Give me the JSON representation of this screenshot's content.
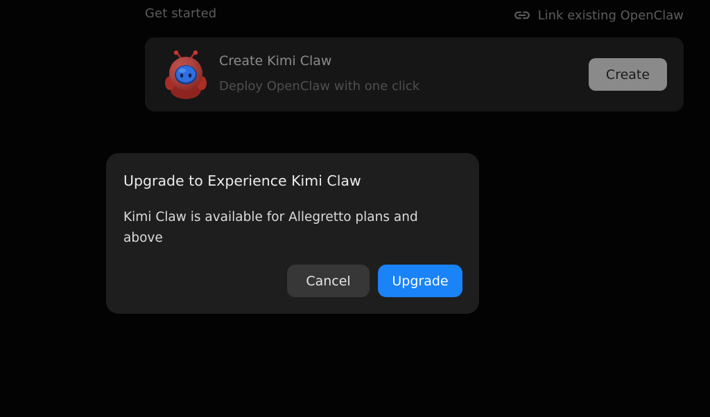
{
  "header": {
    "section_title": "Get started",
    "link_label": "Link existing OpenClaw",
    "link_icon": "link-icon"
  },
  "card": {
    "mascot_icon": "kimi-claw-mascot-icon",
    "title": "Create Kimi Claw",
    "subtitle": "Deploy OpenClaw with one click",
    "create_label": "Create"
  },
  "modal": {
    "title": "Upgrade to Experience Kimi Claw",
    "body": "Kimi Claw is available for Allegretto plans and above",
    "cancel_label": "Cancel",
    "upgrade_label": "Upgrade"
  },
  "colors": {
    "background": "#030303",
    "card_background": "#161616",
    "modal_background": "#1e1e1e",
    "primary_button": "#1983f7",
    "secondary_button": "#373737",
    "mascot_red": "#b3312b",
    "mascot_blue": "#2f6fe0"
  }
}
